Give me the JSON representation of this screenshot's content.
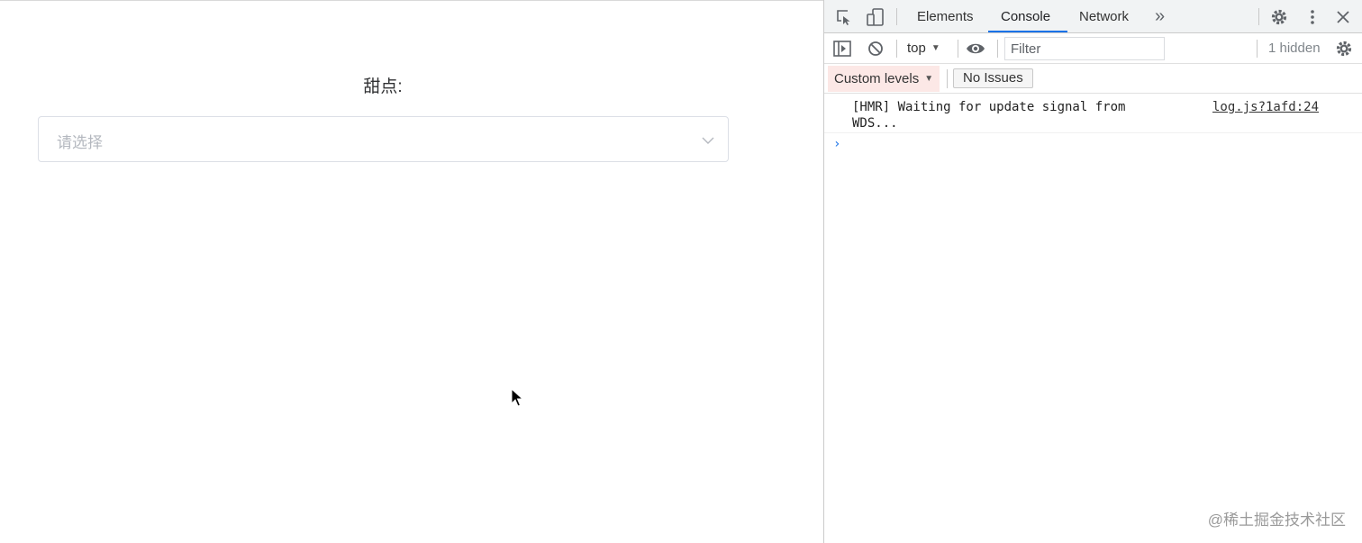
{
  "page": {
    "field_label": "甜点:",
    "select": {
      "placeholder": "请选择"
    }
  },
  "devtools": {
    "tabs": [
      {
        "label": "Elements",
        "active": false
      },
      {
        "label": "Console",
        "active": true
      },
      {
        "label": "Network",
        "active": false
      }
    ],
    "more_tabs_glyph": "»",
    "toolbar": {
      "context": "top",
      "filter_placeholder": "Filter",
      "hidden_count": "1 hidden"
    },
    "levels": {
      "custom_levels": "Custom levels",
      "issues": "No Issues"
    },
    "messages": [
      {
        "text": "[HMR] Waiting for update signal from WDS...",
        "source": "log.js?1afd:24"
      }
    ],
    "prompt_glyph": "›"
  },
  "watermark": "@稀土掘金技术社区",
  "colors": {
    "active_tab_underline": "#1a73e8",
    "levels_highlight": "#fce8e6",
    "placeholder": "#b4b8bf"
  }
}
